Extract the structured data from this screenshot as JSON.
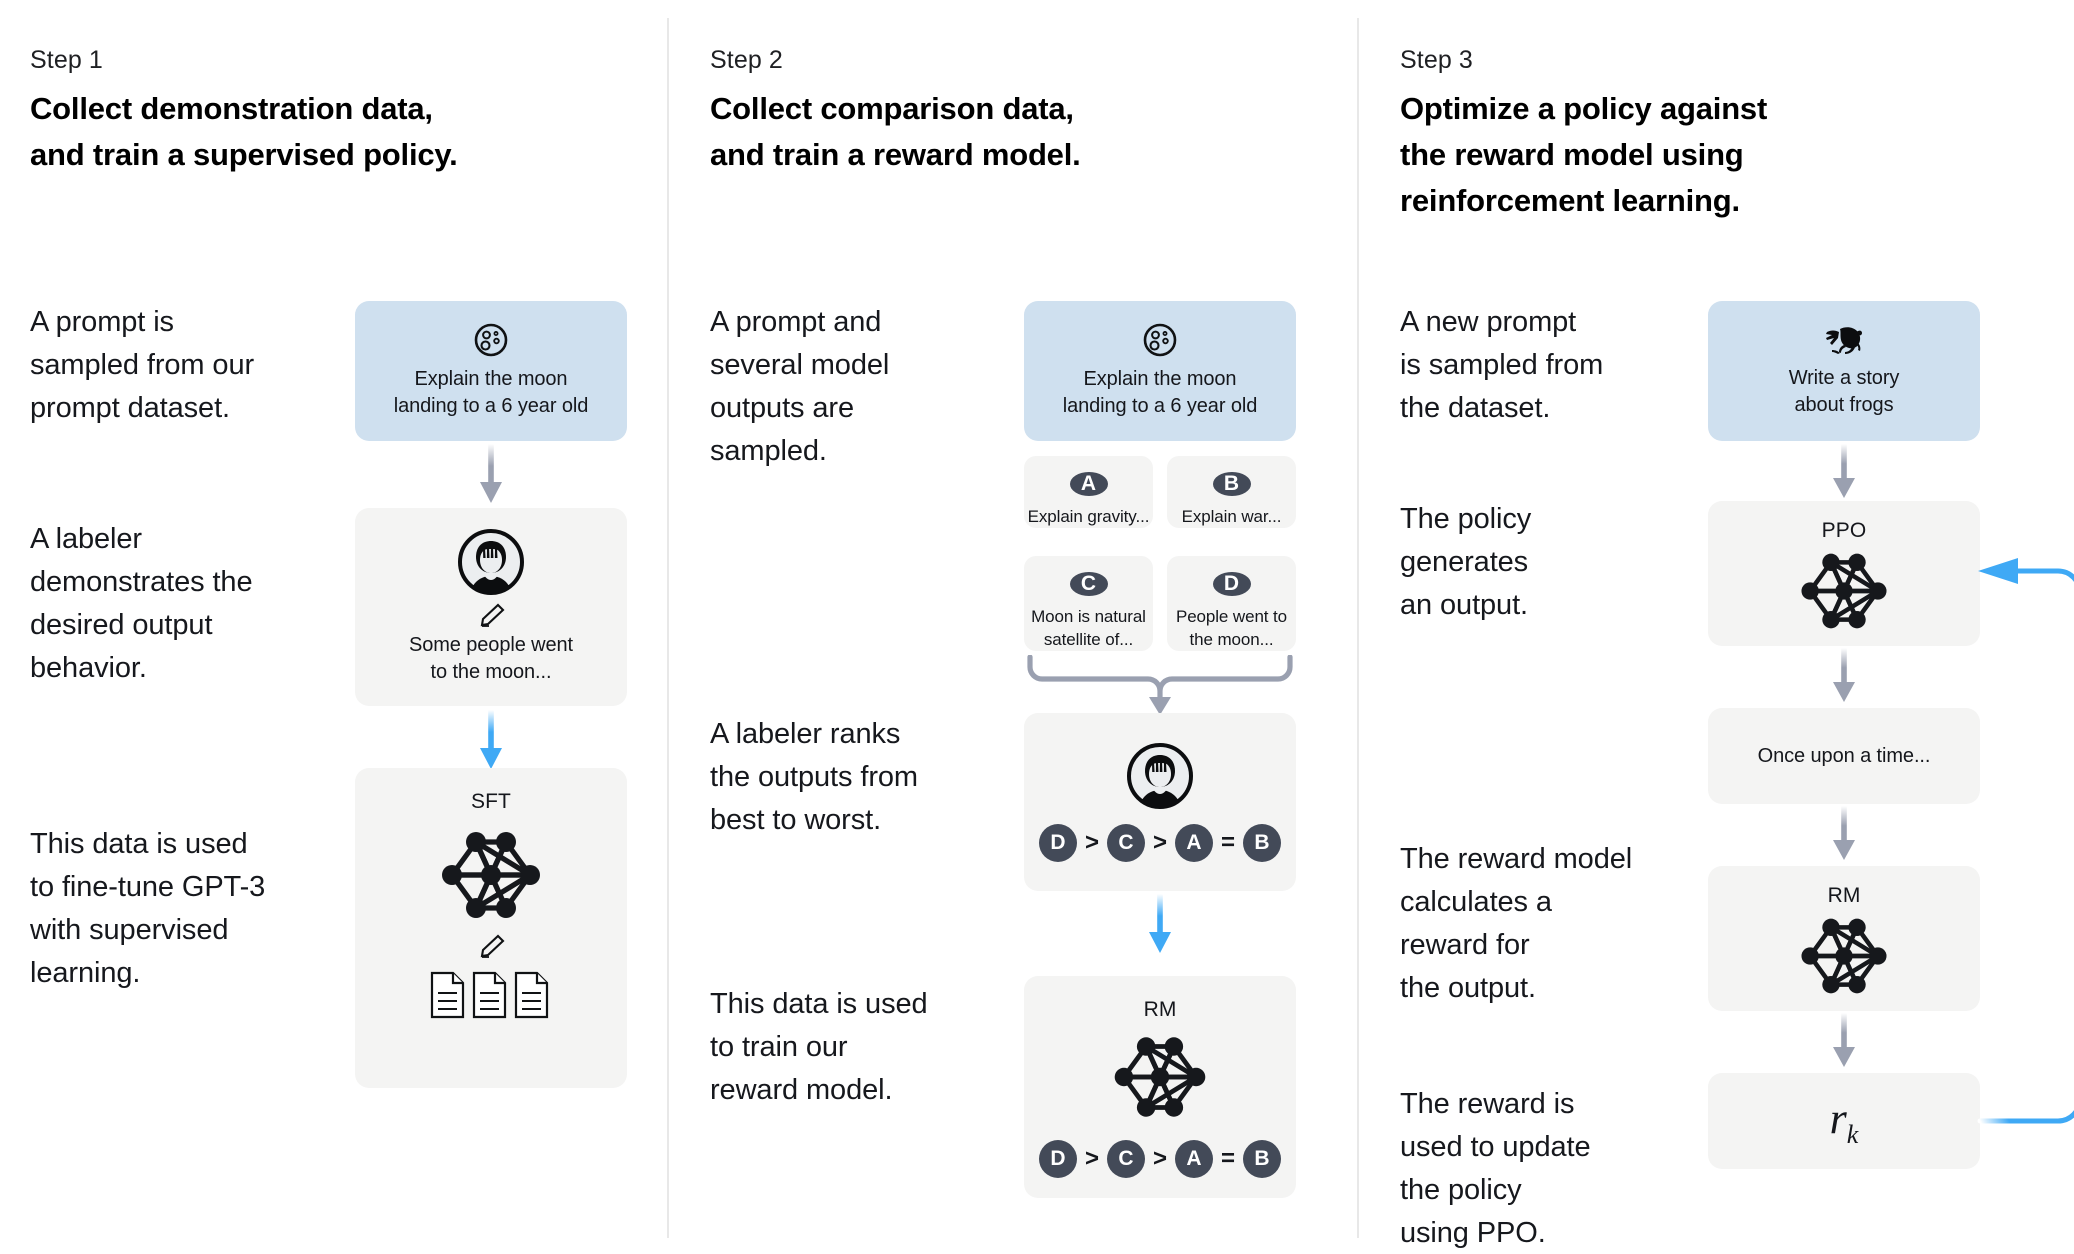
{
  "columns": [
    {
      "step_label": "Step 1",
      "title": "Collect demonstration data,\nand train a supervised policy.",
      "paragraphs": [
        "A prompt is\nsampled from our\nprompt dataset.",
        "A labeler\ndemonstrates the\ndesired output\nbehavior.",
        "This data is used\nto fine-tune GPT-3\nwith supervised\nlearning."
      ],
      "cards": [
        {
          "name": "prompt-card",
          "icon": "moon-icon",
          "text": "Explain the moon\nlanding to a 6 year old",
          "style": "blue"
        },
        {
          "name": "labeler-card",
          "icon": "labeler-avatar-icon",
          "text": "Some people went\nto the moon...",
          "style": "grey"
        },
        {
          "name": "sft-model-card",
          "label": "SFT",
          "icon": "neural-network-icon",
          "style": "grey"
        }
      ],
      "arrows": [
        {
          "name": "arrow-prompt-to-labeler",
          "color": "#9aa0b0"
        },
        {
          "name": "arrow-labeler-to-sft",
          "color": "#3fa9f5"
        }
      ]
    },
    {
      "step_label": "Step 2",
      "title": "Collect comparison data,\nand train a reward model.",
      "paragraphs": [
        "A prompt and\nseveral model\noutputs are\nsampled.",
        "A labeler ranks\nthe outputs from\nbest to worst.",
        "This data is used\nto train our\nreward model."
      ],
      "cards": [
        {
          "name": "prompt-card",
          "icon": "moon-icon",
          "text": "Explain the moon\nlanding to a 6 year old",
          "style": "blue"
        },
        {
          "name": "ranking-card",
          "icon": "labeler-avatar-icon",
          "style": "grey"
        },
        {
          "name": "reward-model-card",
          "label": "RM",
          "icon": "neural-network-icon",
          "style": "grey"
        }
      ],
      "outputs": [
        {
          "name": "output-option-a",
          "letter": "A",
          "text": "Explain gravity..."
        },
        {
          "name": "output-option-b",
          "letter": "B",
          "text": "Explain war..."
        },
        {
          "name": "output-option-c",
          "letter": "C",
          "text": "Moon is natural\nsatellite of..."
        },
        {
          "name": "output-option-d",
          "letter": "D",
          "text": "People went to\nthe moon..."
        }
      ],
      "ranking": [
        "D",
        ">",
        "C",
        ">",
        "A",
        "=",
        "B"
      ],
      "arrows": [
        {
          "name": "arrow-outputs-to-ranking",
          "color": "#9aa0b0"
        },
        {
          "name": "arrow-ranking-to-rm",
          "color": "#3fa9f5"
        }
      ]
    },
    {
      "step_label": "Step 3",
      "title": "Optimize a policy against\nthe reward model using\nreinforcement learning.",
      "paragraphs": [
        "A new prompt\nis sampled from\nthe dataset.",
        "The policy\ngenerates\nan output.",
        "The reward model\ncalculates a\nreward for\nthe output.",
        "The reward is\nused to update\nthe policy\nusing PPO."
      ],
      "cards": [
        {
          "name": "new-prompt-card",
          "icon": "frog-icon",
          "text": "Write a story\nabout frogs",
          "style": "blue"
        },
        {
          "name": "ppo-policy-card",
          "label": "PPO",
          "icon": "neural-network-icon",
          "style": "grey"
        },
        {
          "name": "generated-output-card",
          "text": "Once upon a time...",
          "style": "grey"
        },
        {
          "name": "reward-model-card",
          "label": "RM",
          "icon": "neural-network-icon",
          "style": "grey"
        },
        {
          "name": "reward-value-card",
          "reward_symbol": "r",
          "reward_subscript": "k",
          "style": "grey"
        }
      ],
      "arrows": [
        {
          "name": "arrow-prompt-to-ppo",
          "color": "#9aa0b0"
        },
        {
          "name": "arrow-ppo-to-output",
          "color": "#9aa0b0"
        },
        {
          "name": "arrow-output-to-rm",
          "color": "#9aa0b0"
        },
        {
          "name": "arrow-rm-to-reward",
          "color": "#9aa0b0"
        },
        {
          "name": "feedback-loop-arrow",
          "color": "#3fa9f5"
        }
      ]
    }
  ],
  "colors": {
    "blue_card": "#cfe0ef",
    "grey_card": "#f4f4f3",
    "grey_arrow": "#9aa0b0",
    "blue_arrow": "#3fa9f5",
    "pill": "#434a58",
    "divider": "#e8e8e8"
  }
}
